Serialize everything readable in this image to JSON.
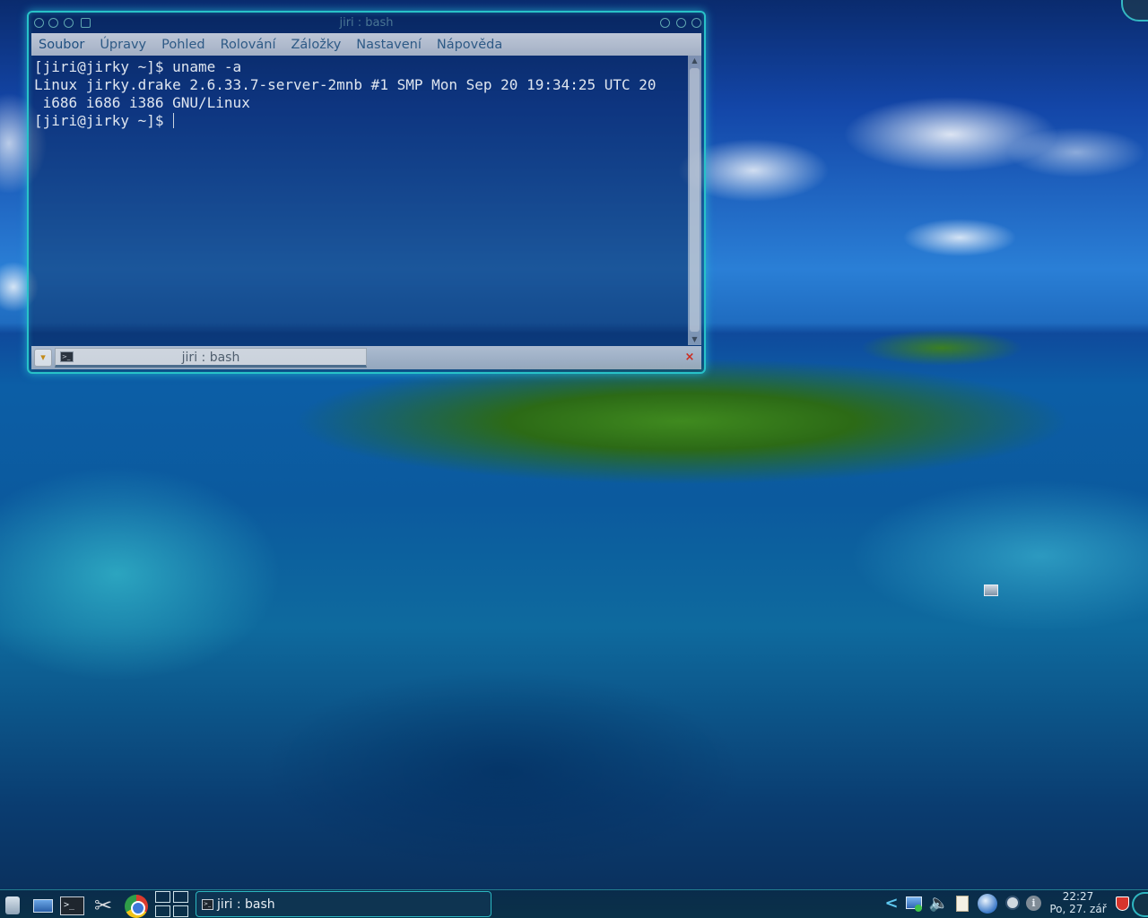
{
  "window": {
    "title": "jiri : bash",
    "menu": [
      "Soubor",
      "Úpravy",
      "Pohled",
      "Rolování",
      "Záložky",
      "Nastavení",
      "Nápověda"
    ],
    "console_lines": [
      "[jiri@jirky ~]$ uname -a",
      "Linux jirky.drake 2.6.33.7-server-2mnb #1 SMP Mon Sep 20 19:34:25 UTC 20",
      " i686 i686 i386 GNU/Linux",
      "[jiri@jirky ~]$ "
    ],
    "tab_label": "jiri : bash",
    "colors": {
      "border": "#28c2c8",
      "menu_text": "#2e5a86",
      "console_text": "#dfe6f0",
      "close_tab": "#cc2a1e"
    }
  },
  "panel": {
    "launchers": [
      "kmenu-icon",
      "show-desktop-icon",
      "konsole-icon",
      "tools-icon",
      "chrome-icon"
    ],
    "pager_desktops": 4,
    "task_label": "jiri : bash",
    "clock": {
      "time": "22:27",
      "date": "Po, 27. zář"
    },
    "tray_icons": [
      "tray-expand-icon",
      "network-icon",
      "volume-icon",
      "clipboard-icon",
      "update-icon",
      "kget-icon",
      "info-icon",
      "shield-icon"
    ],
    "colors": {
      "accent": "#2cb8c2"
    }
  },
  "icons": {
    "tb_close": "⊗",
    "chevron_up": "▲",
    "chevron_down": "▼",
    "tab_close": "×",
    "tools": "✂",
    "tray_arrow": "<",
    "speaker": "🔈",
    "info": "i"
  }
}
